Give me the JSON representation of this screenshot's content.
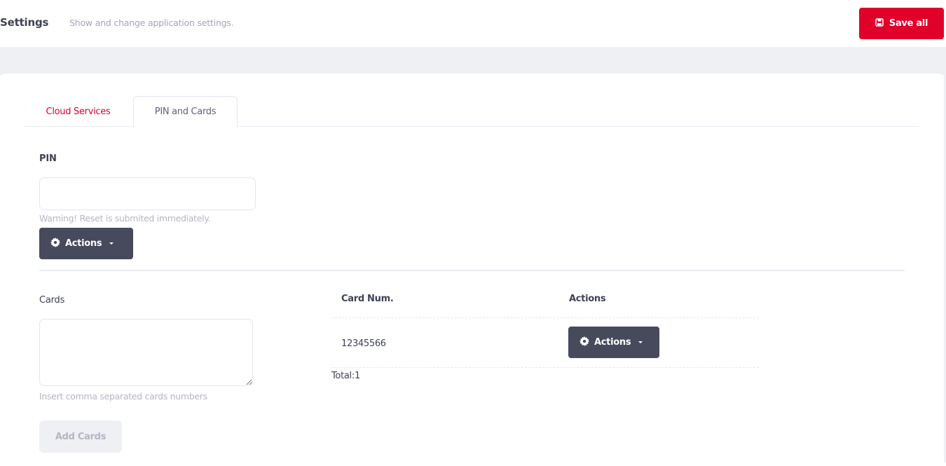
{
  "header": {
    "title": "Settings",
    "description": "Show and change application settings.",
    "save_all_label": "Save all"
  },
  "colors": {
    "accent": "#e1002a",
    "dark_button": "#474a5c",
    "background": "#eef0f4"
  },
  "tabs": [
    {
      "label": "Cloud Services",
      "active": false
    },
    {
      "label": "PIN and Cards",
      "active": true
    }
  ],
  "pin": {
    "label": "PIN",
    "value": "",
    "warning": "Warning! Reset is submited immediately.",
    "actions_label": "Actions"
  },
  "cards": {
    "label": "Cards",
    "textarea_value": "",
    "hint": "Insert comma separated cards numbers",
    "add_label": "Add Cards",
    "table": {
      "columns": [
        "Card Num.",
        "Actions"
      ],
      "rows": [
        {
          "card_num": "12345566",
          "actions_label": "Actions"
        }
      ],
      "total_label": "Total:",
      "total": "1"
    }
  }
}
